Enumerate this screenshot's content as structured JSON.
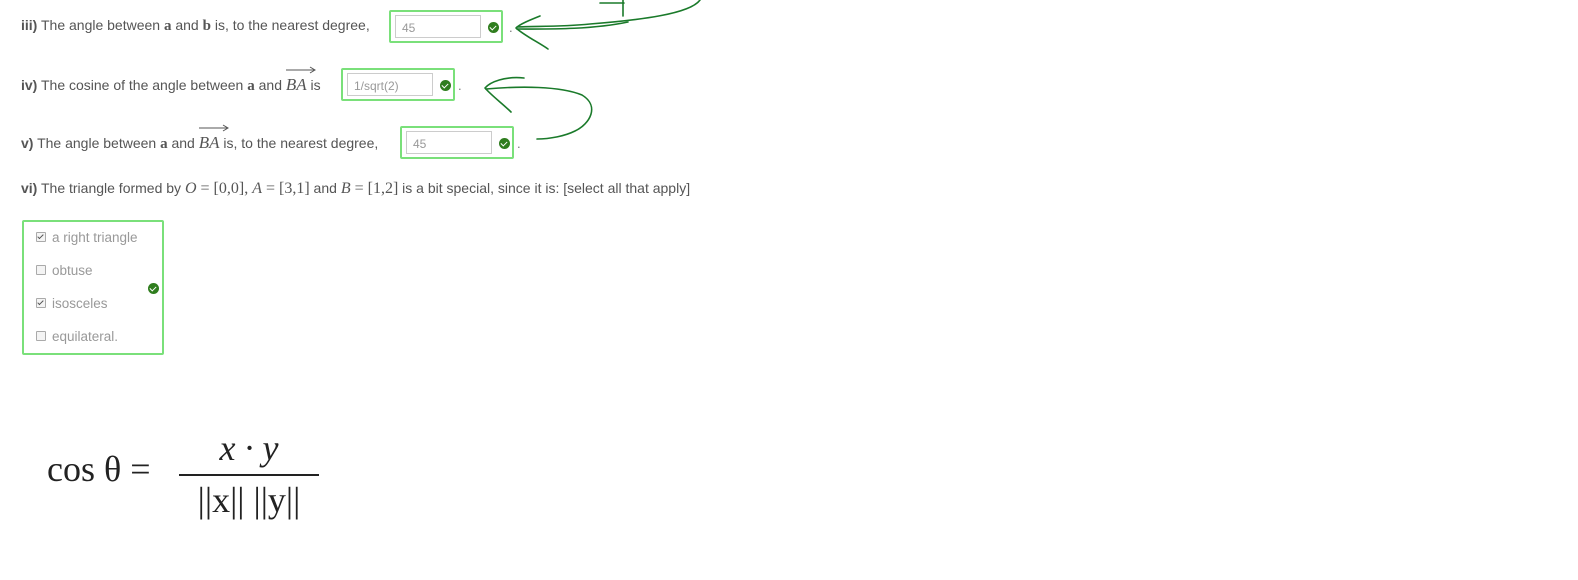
{
  "questions": {
    "q3": {
      "num": "iii)",
      "t1": " The angle between ",
      "a": "a",
      "and": " and ",
      "b": "b",
      "t2": " is, to the nearest degree, ",
      "answer": "45",
      "end": "."
    },
    "q4": {
      "num": "iv)",
      "t1": " The cosine of the angle between ",
      "a": "a",
      "and": " and ",
      "vec": "BA",
      "t2": " is ",
      "answer": "1/sqrt(2)",
      "end": "."
    },
    "q5": {
      "num": "v)",
      "t1": " The angle between ",
      "a": "a",
      "and": " and ",
      "vec": "BA",
      "t2": " is, to the nearest degree, ",
      "answer": "45",
      "end": "."
    },
    "q6": {
      "num": "vi)",
      "t1": " The triangle formed by ",
      "O": "O",
      "Oval": " = [0,0],  ",
      "A": "A",
      "Aval": " = [3,1]",
      "and": "  and ",
      "B": "B",
      "Bval": " = [1,2]",
      "t2": "  is a bit special, since it is: [select all that apply]",
      "options": [
        {
          "label": "a right triangle",
          "checked": true
        },
        {
          "label": "obtuse",
          "checked": false
        },
        {
          "label": "isosceles",
          "checked": true
        },
        {
          "label": "equilateral.",
          "checked": false
        }
      ]
    }
  },
  "formula": {
    "lhs": "cos θ = ",
    "numerator": "x · y",
    "denominator": "||x|| ||y||"
  },
  "colors": {
    "correct_border": "#7ae07a",
    "check": "#2f7d1e",
    "ink": "#1a7a2a"
  },
  "icons": [
    "check-circle-icon"
  ]
}
